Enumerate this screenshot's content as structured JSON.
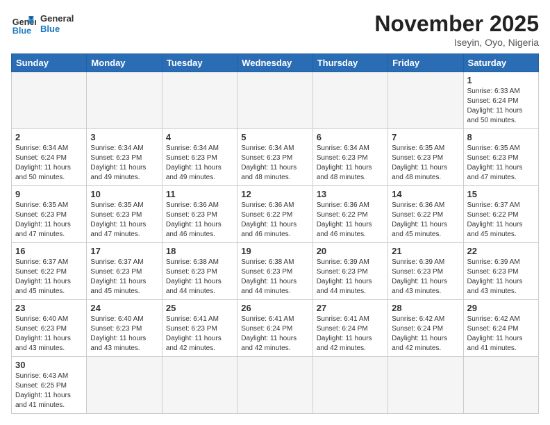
{
  "logo": {
    "line1": "General",
    "line2": "Blue"
  },
  "header": {
    "title": "November 2025",
    "subtitle": "Iseyin, Oyo, Nigeria"
  },
  "weekdays": [
    "Sunday",
    "Monday",
    "Tuesday",
    "Wednesday",
    "Thursday",
    "Friday",
    "Saturday"
  ],
  "weeks": [
    [
      {
        "day": "",
        "info": ""
      },
      {
        "day": "",
        "info": ""
      },
      {
        "day": "",
        "info": ""
      },
      {
        "day": "",
        "info": ""
      },
      {
        "day": "",
        "info": ""
      },
      {
        "day": "",
        "info": ""
      },
      {
        "day": "1",
        "info": "Sunrise: 6:33 AM\nSunset: 6:24 PM\nDaylight: 11 hours\nand 50 minutes."
      }
    ],
    [
      {
        "day": "2",
        "info": "Sunrise: 6:34 AM\nSunset: 6:24 PM\nDaylight: 11 hours\nand 50 minutes."
      },
      {
        "day": "3",
        "info": "Sunrise: 6:34 AM\nSunset: 6:23 PM\nDaylight: 11 hours\nand 49 minutes."
      },
      {
        "day": "4",
        "info": "Sunrise: 6:34 AM\nSunset: 6:23 PM\nDaylight: 11 hours\nand 49 minutes."
      },
      {
        "day": "5",
        "info": "Sunrise: 6:34 AM\nSunset: 6:23 PM\nDaylight: 11 hours\nand 48 minutes."
      },
      {
        "day": "6",
        "info": "Sunrise: 6:34 AM\nSunset: 6:23 PM\nDaylight: 11 hours\nand 48 minutes."
      },
      {
        "day": "7",
        "info": "Sunrise: 6:35 AM\nSunset: 6:23 PM\nDaylight: 11 hours\nand 48 minutes."
      },
      {
        "day": "8",
        "info": "Sunrise: 6:35 AM\nSunset: 6:23 PM\nDaylight: 11 hours\nand 47 minutes."
      }
    ],
    [
      {
        "day": "9",
        "info": "Sunrise: 6:35 AM\nSunset: 6:23 PM\nDaylight: 11 hours\nand 47 minutes."
      },
      {
        "day": "10",
        "info": "Sunrise: 6:35 AM\nSunset: 6:23 PM\nDaylight: 11 hours\nand 47 minutes."
      },
      {
        "day": "11",
        "info": "Sunrise: 6:36 AM\nSunset: 6:23 PM\nDaylight: 11 hours\nand 46 minutes."
      },
      {
        "day": "12",
        "info": "Sunrise: 6:36 AM\nSunset: 6:22 PM\nDaylight: 11 hours\nand 46 minutes."
      },
      {
        "day": "13",
        "info": "Sunrise: 6:36 AM\nSunset: 6:22 PM\nDaylight: 11 hours\nand 46 minutes."
      },
      {
        "day": "14",
        "info": "Sunrise: 6:36 AM\nSunset: 6:22 PM\nDaylight: 11 hours\nand 45 minutes."
      },
      {
        "day": "15",
        "info": "Sunrise: 6:37 AM\nSunset: 6:22 PM\nDaylight: 11 hours\nand 45 minutes."
      }
    ],
    [
      {
        "day": "16",
        "info": "Sunrise: 6:37 AM\nSunset: 6:22 PM\nDaylight: 11 hours\nand 45 minutes."
      },
      {
        "day": "17",
        "info": "Sunrise: 6:37 AM\nSunset: 6:23 PM\nDaylight: 11 hours\nand 45 minutes."
      },
      {
        "day": "18",
        "info": "Sunrise: 6:38 AM\nSunset: 6:23 PM\nDaylight: 11 hours\nand 44 minutes."
      },
      {
        "day": "19",
        "info": "Sunrise: 6:38 AM\nSunset: 6:23 PM\nDaylight: 11 hours\nand 44 minutes."
      },
      {
        "day": "20",
        "info": "Sunrise: 6:39 AM\nSunset: 6:23 PM\nDaylight: 11 hours\nand 44 minutes."
      },
      {
        "day": "21",
        "info": "Sunrise: 6:39 AM\nSunset: 6:23 PM\nDaylight: 11 hours\nand 43 minutes."
      },
      {
        "day": "22",
        "info": "Sunrise: 6:39 AM\nSunset: 6:23 PM\nDaylight: 11 hours\nand 43 minutes."
      }
    ],
    [
      {
        "day": "23",
        "info": "Sunrise: 6:40 AM\nSunset: 6:23 PM\nDaylight: 11 hours\nand 43 minutes."
      },
      {
        "day": "24",
        "info": "Sunrise: 6:40 AM\nSunset: 6:23 PM\nDaylight: 11 hours\nand 43 minutes."
      },
      {
        "day": "25",
        "info": "Sunrise: 6:41 AM\nSunset: 6:23 PM\nDaylight: 11 hours\nand 42 minutes."
      },
      {
        "day": "26",
        "info": "Sunrise: 6:41 AM\nSunset: 6:24 PM\nDaylight: 11 hours\nand 42 minutes."
      },
      {
        "day": "27",
        "info": "Sunrise: 6:41 AM\nSunset: 6:24 PM\nDaylight: 11 hours\nand 42 minutes."
      },
      {
        "day": "28",
        "info": "Sunrise: 6:42 AM\nSunset: 6:24 PM\nDaylight: 11 hours\nand 42 minutes."
      },
      {
        "day": "29",
        "info": "Sunrise: 6:42 AM\nSunset: 6:24 PM\nDaylight: 11 hours\nand 41 minutes."
      }
    ],
    [
      {
        "day": "30",
        "info": "Sunrise: 6:43 AM\nSunset: 6:25 PM\nDaylight: 11 hours\nand 41 minutes."
      },
      {
        "day": "",
        "info": ""
      },
      {
        "day": "",
        "info": ""
      },
      {
        "day": "",
        "info": ""
      },
      {
        "day": "",
        "info": ""
      },
      {
        "day": "",
        "info": ""
      },
      {
        "day": "",
        "info": ""
      }
    ]
  ]
}
